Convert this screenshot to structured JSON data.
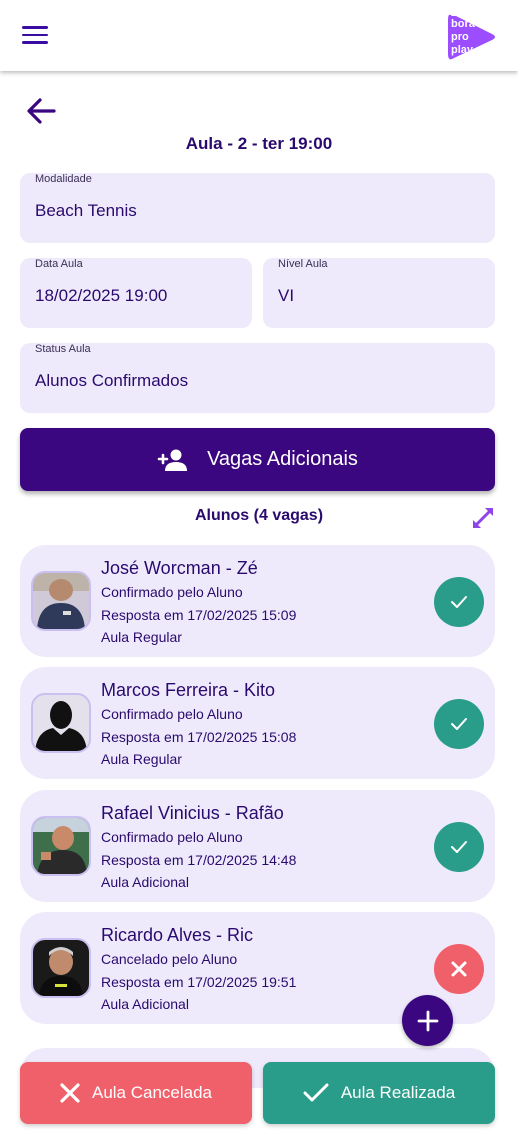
{
  "header": {
    "logo_text": [
      "bora",
      "pro",
      "play"
    ],
    "brand_color": "#3a0780",
    "logo_color": "#9b4dff"
  },
  "page": {
    "title": "Aula - 2 - ter 19:00"
  },
  "form": {
    "modalidade": {
      "label": "Modalidade",
      "value": "Beach Tennis"
    },
    "data_aula": {
      "label": "Data Aula",
      "value": "18/02/2025 19:00"
    },
    "nivel_aula": {
      "label": "Nível Aula",
      "value": "VI"
    },
    "status_aula": {
      "label": "Status Aula",
      "value": "Alunos Confirmados"
    }
  },
  "vagas_button": {
    "label": "Vagas Adicionais",
    "icon": "person-add-icon"
  },
  "alunos": {
    "header": "Alunos (4 vagas)",
    "items": [
      {
        "name": "José Worcman  - Zé",
        "status": "Confirmado pelo Aluno",
        "resposta": "Resposta em 17/02/2025 15:09",
        "tipo": "Aula Regular",
        "state": "confirmed"
      },
      {
        "name": "Marcos  Ferreira  - Kito",
        "status": "Confirmado pelo Aluno",
        "resposta": "Resposta em 17/02/2025 15:08",
        "tipo": "Aula Regular",
        "state": "confirmed"
      },
      {
        "name": "Rafael Vinicius  - Rafão",
        "status": "Confirmado pelo Aluno",
        "resposta": "Resposta em 17/02/2025 14:48",
        "tipo": "Aula Adicional",
        "state": "confirmed"
      },
      {
        "name": "Ricardo Alves - Ric",
        "status": "Cancelado pelo Aluno",
        "resposta": "Resposta em 17/02/2025 19:51",
        "tipo": "Aula Adicional",
        "state": "cancelled"
      }
    ]
  },
  "actions": {
    "cancel_label": "Aula Cancelada",
    "done_label": "Aula Realizada",
    "cancel_color": "#f0606a",
    "done_color": "#2a9d8a"
  }
}
